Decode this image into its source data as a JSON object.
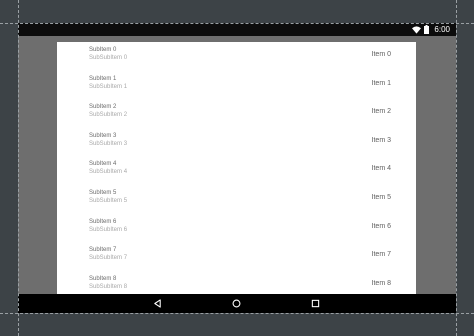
{
  "status_bar": {
    "time": "6:00",
    "icons": [
      "wifi-icon",
      "battery-icon"
    ]
  },
  "list": {
    "rows": [
      {
        "title": "SubItem 0",
        "subtitle": "SubSubItem 0",
        "item": "Item 0"
      },
      {
        "title": "SubItem 1",
        "subtitle": "SubSubItem 1",
        "item": "Item 1"
      },
      {
        "title": "SubItem 2",
        "subtitle": "SubSubItem 2",
        "item": "Item 2"
      },
      {
        "title": "SubItem 3",
        "subtitle": "SubSubItem 3",
        "item": "Item 3"
      },
      {
        "title": "SubItem 4",
        "subtitle": "SubSubItem 4",
        "item": "Item 4"
      },
      {
        "title": "SubItem 5",
        "subtitle": "SubSubItem 5",
        "item": "Item 5"
      },
      {
        "title": "SubItem 6",
        "subtitle": "SubSubItem 6",
        "item": "Item 6"
      },
      {
        "title": "SubItem 7",
        "subtitle": "SubSubItem 7",
        "item": "Item 7"
      },
      {
        "title": "SubItem 8",
        "subtitle": "SubSubItem 8",
        "item": "Item 8"
      }
    ]
  },
  "nav_bar": {
    "buttons": [
      "back-icon",
      "home-icon",
      "recents-icon"
    ]
  },
  "colors": {
    "page_background": "#3d4347",
    "scrim": "#6e6e6e",
    "sheet": "#ffffff",
    "status_bar": "#0c0c0c",
    "nav_bar": "#000000"
  }
}
